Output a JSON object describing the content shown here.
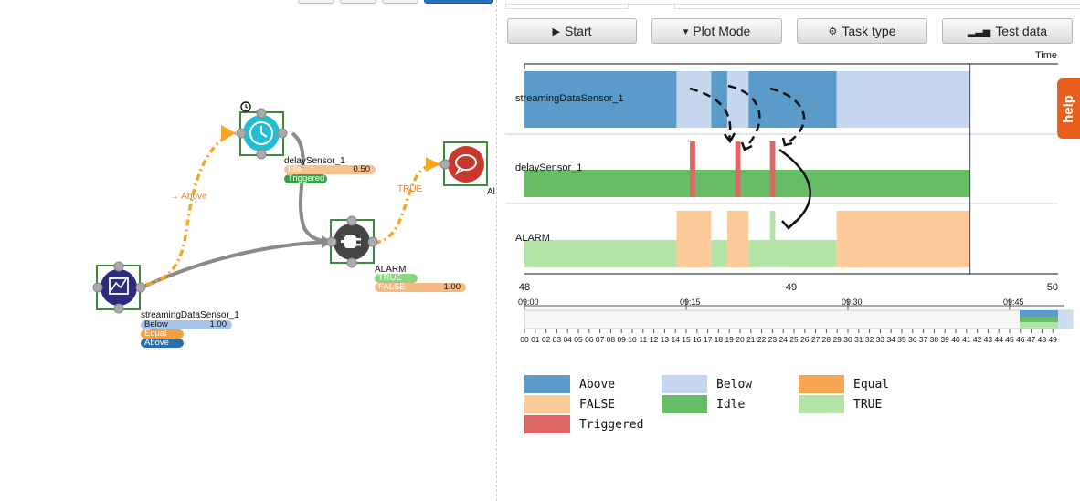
{
  "toolbar": {
    "start_label": "Start",
    "plot_mode_label": "Plot Mode",
    "task_type_label": "Task type",
    "test_data_label": "Test data"
  },
  "help_label": "help",
  "flow": {
    "nodes": {
      "sensor": {
        "name": "streamingDataSensor_1",
        "states": [
          {
            "label": "Below",
            "value": "1.00",
            "color": "#a9c4e6"
          },
          {
            "label": "Equal",
            "value": "",
            "color": "#f59f45"
          },
          {
            "label": "Above",
            "value": "",
            "color": "#2b6ea8"
          }
        ]
      },
      "delay": {
        "name": "delaySensor_1",
        "states": [
          {
            "label": "Idle",
            "value": "0.50",
            "color": "#f9c28d"
          },
          {
            "label": "Triggered",
            "value": "",
            "color": "#3aa149"
          }
        ]
      },
      "alarm": {
        "name": "ALARM",
        "states": [
          {
            "label": "TRUE",
            "value": "",
            "color": "#8ad57e"
          },
          {
            "label": "FALSE",
            "value": "1.00",
            "color": "#f6b984"
          }
        ]
      },
      "output": {
        "name": "Al"
      }
    },
    "edges": [
      {
        "label": "→ Above"
      },
      {
        "label": "TRUE"
      }
    ]
  },
  "timeline": {
    "time_label": "Time 09",
    "rows": [
      "streamingDataSensor_1",
      "delaySensor_1",
      "ALARM"
    ],
    "x_axis": {
      "ticks": [
        "48",
        "49",
        "50"
      ],
      "xlim": [
        48,
        50
      ]
    },
    "overview_ticks": [
      "09:00",
      "09:15",
      "09:30",
      "09:45"
    ],
    "minutes": [
      "00",
      "01",
      "02",
      "03",
      "04",
      "05",
      "06",
      "07",
      "08",
      "09",
      "10",
      "11",
      "12",
      "13",
      "14",
      "15",
      "16",
      "17",
      "18",
      "19",
      "20",
      "21",
      "22",
      "23",
      "24",
      "25",
      "26",
      "27",
      "28",
      "29",
      "30",
      "31",
      "32",
      "33",
      "34",
      "35",
      "36",
      "37",
      "38",
      "39",
      "40",
      "41",
      "42",
      "43",
      "44",
      "45",
      "46",
      "47",
      "48",
      "49"
    ],
    "cursor": 49.67
  },
  "chart_data": {
    "type": "timeline",
    "xlim": [
      48,
      50
    ],
    "rows": [
      {
        "name": "streamingDataSensor_1",
        "segments": [
          {
            "start": 48.0,
            "end": 48.57,
            "state": "Above"
          },
          {
            "start": 48.57,
            "end": 48.7,
            "state": "Below"
          },
          {
            "start": 48.7,
            "end": 48.76,
            "state": "Above"
          },
          {
            "start": 48.76,
            "end": 48.84,
            "state": "Below"
          },
          {
            "start": 48.84,
            "end": 49.17,
            "state": "Above"
          },
          {
            "start": 49.17,
            "end": 49.67,
            "state": "Below"
          }
        ]
      },
      {
        "name": "delaySensor_1",
        "segments": [
          {
            "start": 48.0,
            "end": 49.67,
            "state": "Idle"
          },
          {
            "start": 48.62,
            "end": 48.64,
            "state": "Triggered"
          },
          {
            "start": 48.79,
            "end": 48.81,
            "state": "Triggered"
          },
          {
            "start": 48.92,
            "end": 48.94,
            "state": "Triggered"
          }
        ]
      },
      {
        "name": "ALARM",
        "segments": [
          {
            "start": 48.0,
            "end": 48.57,
            "state": "TRUE"
          },
          {
            "start": 48.57,
            "end": 48.7,
            "state": "FALSE"
          },
          {
            "start": 48.7,
            "end": 48.76,
            "state": "TRUE"
          },
          {
            "start": 48.76,
            "end": 48.84,
            "state": "FALSE"
          },
          {
            "start": 48.84,
            "end": 48.92,
            "state": "TRUE"
          },
          {
            "start": 48.92,
            "end": 48.94,
            "state": "TRUE"
          },
          {
            "start": 48.94,
            "end": 49.17,
            "state": "TRUE"
          },
          {
            "start": 49.17,
            "end": 49.67,
            "state": "FALSE"
          }
        ]
      }
    ],
    "legend": [
      {
        "label": "Above",
        "color": "#5b9bc9"
      },
      {
        "label": "Below",
        "color": "#c4d7ee"
      },
      {
        "label": "Equal",
        "color": "#f7a655"
      },
      {
        "label": "FALSE",
        "color": "#fdcb9a"
      },
      {
        "label": "Idle",
        "color": "#67bd66"
      },
      {
        "label": "TRUE",
        "color": "#b4e3a8"
      },
      {
        "label": "Triggered",
        "color": "#e06666"
      }
    ]
  }
}
